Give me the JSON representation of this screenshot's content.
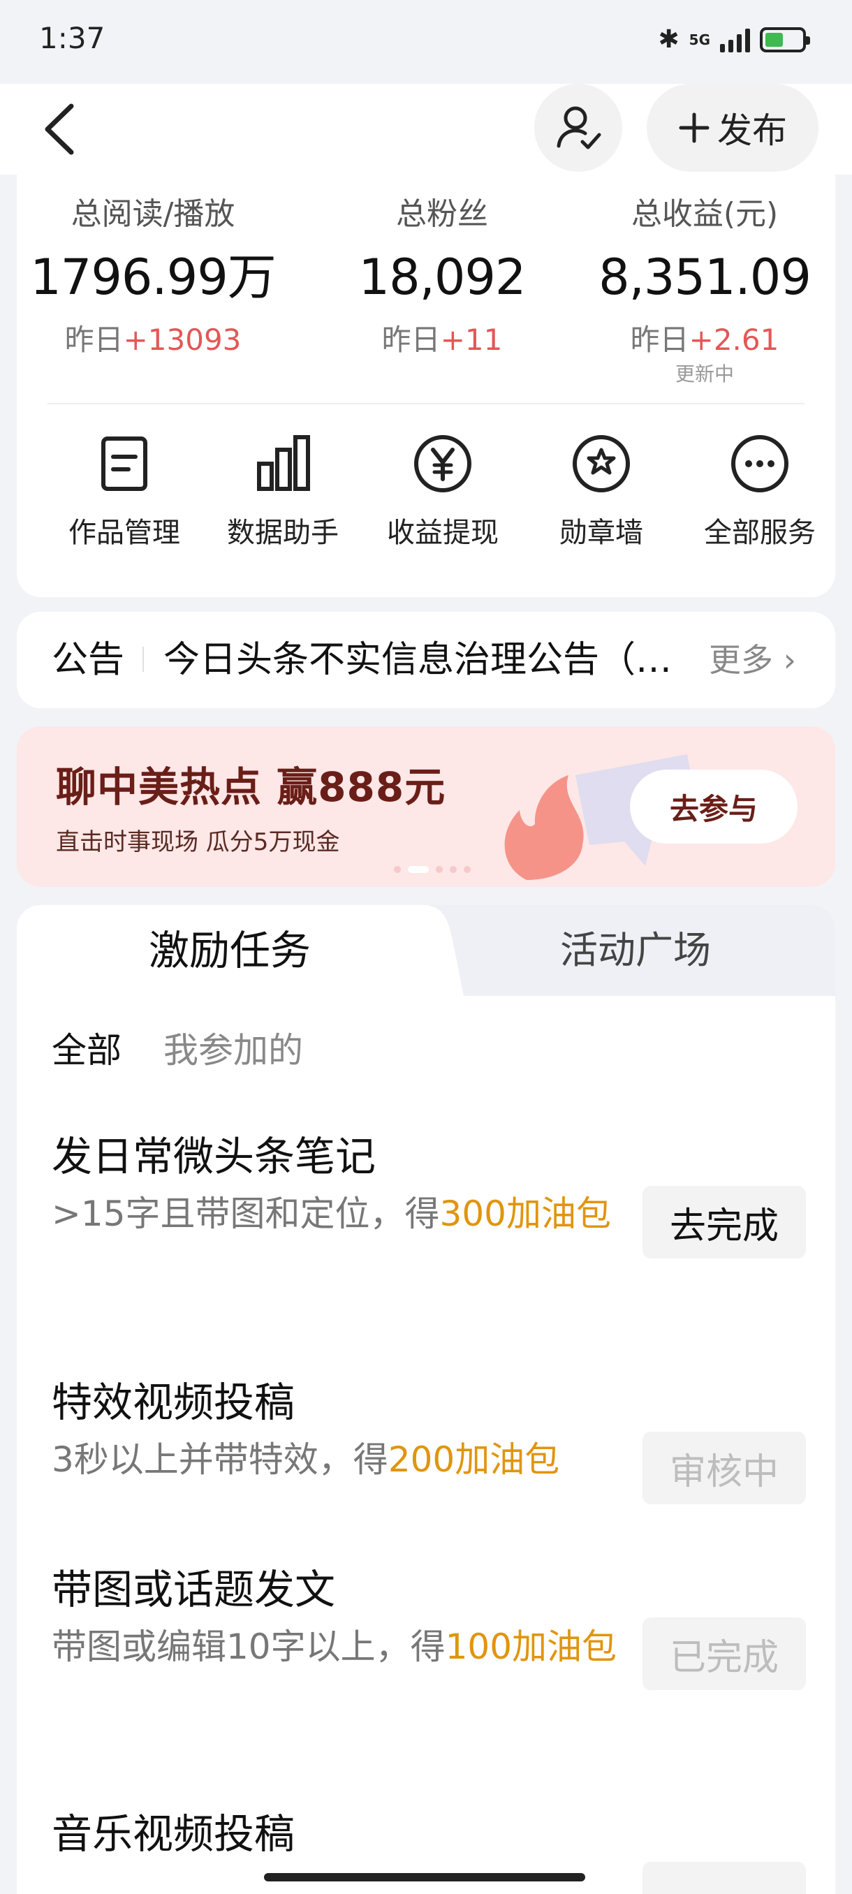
{
  "status_bar": {
    "time": "1:37",
    "network": "5G"
  },
  "nav": {
    "publish_label": "发布"
  },
  "stats": [
    {
      "label": "总阅读/播放",
      "value": "1796.99万",
      "delta_prefix": "昨日",
      "delta": "+13093",
      "note": ""
    },
    {
      "label": "总粉丝",
      "value": "18,092",
      "delta_prefix": "昨日",
      "delta": "+11",
      "note": ""
    },
    {
      "label": "总收益(元)",
      "value": "8,351.09",
      "delta_prefix": "昨日",
      "delta": "+2.61",
      "note": "更新中"
    }
  ],
  "services": [
    {
      "label": "作品管理",
      "icon": "document-icon"
    },
    {
      "label": "数据助手",
      "icon": "bar-chart-icon"
    },
    {
      "label": "收益提现",
      "icon": "yuan-icon"
    },
    {
      "label": "勋章墙",
      "icon": "medal-icon"
    },
    {
      "label": "全部服务",
      "icon": "more-icon"
    }
  ],
  "notice": {
    "tag": "公告",
    "text": "今日头条不实信息治理公告（…",
    "more": "更多"
  },
  "banner": {
    "title": "聊中美热点 赢888元",
    "subtitle": "直击时事现场 瓜分5万现金",
    "cta": "去参与",
    "page_count": 5,
    "active_page": 1
  },
  "tabs": {
    "active": "激励任务",
    "inactive": "活动广场"
  },
  "filters": [
    "全部",
    "我参加的"
  ],
  "tasks": [
    {
      "title": "发日常微头条笔记",
      "desc": ">15字且带图和定位，得",
      "reward": "300加油包",
      "button": "去完成",
      "state": "go"
    },
    {
      "title": "特效视频投稿",
      "desc": "3秒以上并带特效，得",
      "reward": "200加油包",
      "button": "审核中",
      "state": "muted"
    },
    {
      "title": "带图或话题发文",
      "desc": "带图或编辑10字以上，得",
      "reward": "100加油包",
      "button": "已完成",
      "state": "muted"
    },
    {
      "title": "音乐视频投稿",
      "desc": "",
      "reward": "",
      "button": "",
      "state": "muted"
    }
  ],
  "colors": {
    "accent_red": "#e35757",
    "reward_orange": "#e0950f",
    "banner_bg": "#fde7e7",
    "banner_text": "#6a1e18"
  }
}
